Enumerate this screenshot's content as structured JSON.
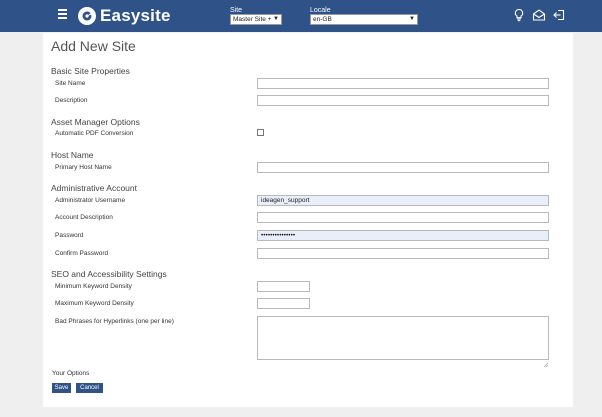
{
  "header": {
    "brand": "Easysite",
    "site_label": "Site",
    "site_value": "Master Site +",
    "locale_label": "Locale",
    "locale_value": "en-GB"
  },
  "page": {
    "title": "Add New Site"
  },
  "sections": {
    "basic": {
      "title": "Basic Site Properties",
      "site_name_label": "Site Name",
      "site_name_value": "",
      "description_label": "Description",
      "description_value": ""
    },
    "asset": {
      "title": "Asset Manager Options",
      "pdf_label": "Automatic PDF Conversion",
      "pdf_checked": false
    },
    "host": {
      "title": "Host Name",
      "primary_host_label": "Primary Host Name",
      "primary_host_value": ""
    },
    "admin": {
      "title": "Administrative Account",
      "username_label": "Administrator Username",
      "username_value": "ideagen_support",
      "account_desc_label": "Account Description",
      "account_desc_value": "",
      "password_label": "Password",
      "password_value": "•••••••••••••••",
      "confirm_password_label": "Confirm Password",
      "confirm_password_value": ""
    },
    "seo": {
      "title": "SEO and Accessibility Settings",
      "min_keyword_label": "Minimum Keyword Density",
      "min_keyword_value": "",
      "max_keyword_label": "Maximum Keyword Density",
      "max_keyword_value": "",
      "bad_phrases_label": "Bad Phrases for Hyperlinks (one per line)",
      "bad_phrases_value": ""
    }
  },
  "footer": {
    "options_label": "Your Options",
    "save_label": "Save",
    "cancel_label": "Cancel"
  },
  "colors": {
    "topbar": "#2f5289",
    "autofill": "#e8effa",
    "button": "#2f5289"
  },
  "icons": [
    "menu-icon",
    "easysite-logo-icon",
    "lightbulb-icon",
    "mail-icon",
    "logout-icon"
  ]
}
